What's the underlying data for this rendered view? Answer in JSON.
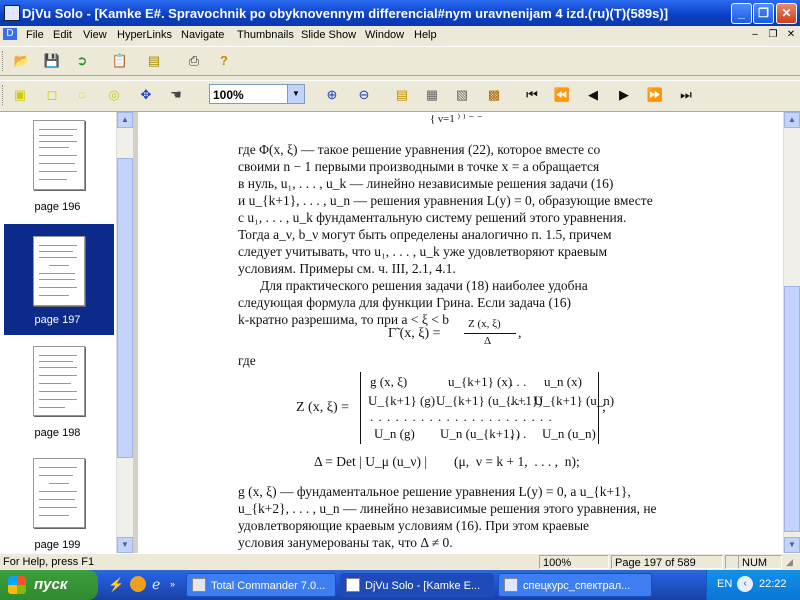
{
  "window": {
    "title": "DjVu Solo - [Kamke E#. Spravochnik po obyknovennym differencial#nym uravnenijam 4 izd.(ru)(T)(589s)]"
  },
  "menu": [
    "File",
    "Edit",
    "View",
    "HyperLinks",
    "Navigate",
    "Thumbnails",
    "Slide Show",
    "Window",
    "Help"
  ],
  "toolbar": {
    "zoom_value": "100%"
  },
  "thumbnails": [
    {
      "label": "page 196",
      "selected": false
    },
    {
      "label": "page 197",
      "selected": true
    },
    {
      "label": "page 198",
      "selected": false
    },
    {
      "label": "page 199",
      "selected": false
    }
  ],
  "document": {
    "p1": [
      "где Φ(x, ξ) — такое решение уравнения (22), которое вместе со",
      "своими n − 1 первыми производными в точке x = a обращается",
      "в нуль, u₁, . . . , u_k — линейно независимые решения задачи (16)",
      "и u_{k+1}, . . . , u_n — решения уравнения L(y) = 0, образующие вместе",
      "с u₁, . . . , u_k фундаментальную систему решений этого уравнения.",
      "Тогда a_ν, b_ν могут быть определены аналогично п. 1.5, причем",
      "следует учитывать, что u₁, . . . , u_k уже удовлетворяют краевым",
      "условиям. Примеры см. ч. III, 2.1, 4.1."
    ],
    "p2": [
      "Для практического решения задачи (18) наиболее удобна",
      "следующая формула для функции Грина. Если задача (16)",
      "k-кратно разрешима, то при a < ξ < b"
    ],
    "formula1_lhs": "Γ̃ (x, ξ) =",
    "formula1_num": "Z (x, ξ)",
    "formula1_den": "Δ",
    "where": "где",
    "z_lhs": "Z (x, ξ) =",
    "matrix": [
      [
        "g (x, ξ)",
        "u_{k+1} (x)",
        ". . .",
        "u_n (x)"
      ],
      [
        "U_{k+1} (g)",
        "U_{k+1} (u_{k+1})",
        ". . .",
        "U_{k+1} (u_n)"
      ],
      [
        ". . . . . . . . . . . . . . . . . . . . . ."
      ],
      [
        "U_n (g)",
        "U_n (u_{k+1})",
        ". . .",
        "U_n (u_n)"
      ]
    ],
    "delta_line": "Δ = Det | U_μ (u_ν) |        (μ,  ν = k + 1,  . . . ,  n);",
    "p3": [
      "g (x, ξ) — фундаментальное решение уравнения L(y) = 0, а u_{k+1},",
      "u_{k+2}, . . . , u_n — линейно независимые решения этого уравнения, не",
      "удовлетворяющие краевым условиям (16). При этом краевые",
      "условия занумерованы так, что Δ ≠ 0."
    ]
  },
  "status": {
    "help": "For Help, press F1",
    "zoom": "100%",
    "page": "Page 197 of 589",
    "num": "NUM"
  },
  "taskbar": {
    "start": "пуск",
    "tasks": [
      {
        "label": "Total Commander 7.0...",
        "active": false
      },
      {
        "label": "DjVu Solo - [Kamke E...",
        "active": true
      },
      {
        "label": "спецкурс_спектрал...",
        "active": false
      }
    ],
    "lang": "EN",
    "clock": "22:22"
  }
}
